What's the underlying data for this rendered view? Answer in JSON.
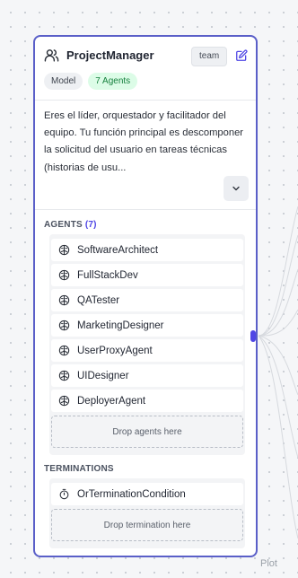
{
  "node": {
    "title": "ProjectManager",
    "type_badge": "team",
    "model_badge": "Model",
    "agents_badge": "7 Agents",
    "description": "Eres el líder, orquestador y facilitador del equipo. Tu función principal es descomponer la solicitud del usuario en tareas técnicas (historias de usu...",
    "icons": {
      "header": "users-icon",
      "edit": "edit-icon",
      "expand": "chevron-down-icon",
      "agent": "bot-icon",
      "termination": "timer-icon"
    }
  },
  "agents": {
    "label": "AGENTS",
    "count": "(7)",
    "items": [
      "SoftwareArchitect",
      "FullStackDev",
      "QATester",
      "MarketingDesigner",
      "UserProxyAgent",
      "UIDesigner",
      "DeployerAgent"
    ],
    "drop_text": "Drop agents here"
  },
  "terminations": {
    "label": "TERMINATIONS",
    "items": [
      "OrTerminationCondition"
    ],
    "drop_text": "Drop termination here"
  },
  "watermark": "Plot",
  "colors": {
    "accent": "#4f46e5",
    "card_border": "#5a5fc8",
    "agents_badge_bg": "#dcfce7",
    "agents_badge_text": "#15803d"
  }
}
